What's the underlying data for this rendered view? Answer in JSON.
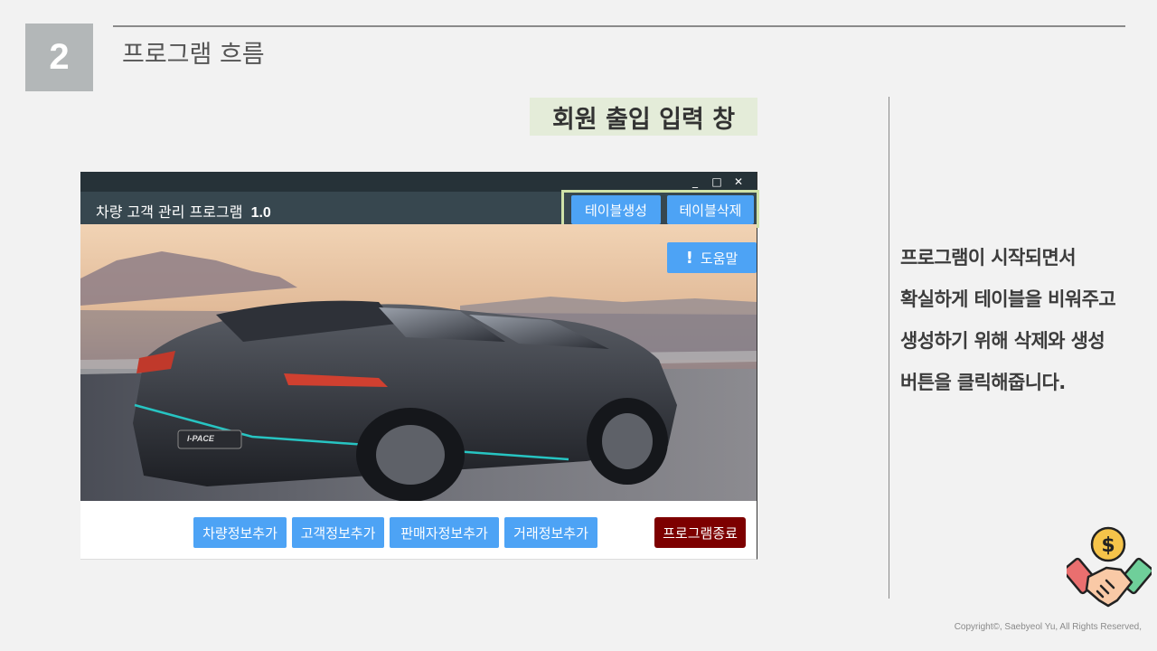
{
  "slide": {
    "number": "2",
    "title": "프로그램 흐름",
    "caption": "회원 출입 입력 창",
    "description_lines": [
      "프로그램이 시작되면서",
      "확실하게 테이블을 비워주고",
      "생성하기 위해 삭제와 생성",
      "버튼을 클릭해줍니다."
    ],
    "copyright": "Copyright©, Saebyeol Yu, All Rights Reserved,"
  },
  "app": {
    "title": "차량 고객 관리 프로그램",
    "version": "1.0",
    "window_buttons": {
      "minimize": "_",
      "maximize": "□",
      "close": "✕"
    },
    "create_table_label": "테이블생성",
    "delete_table_label": "테이블삭제",
    "help_icon": "!",
    "help_label": "도움말",
    "bottom_buttons": [
      "차량정보추가",
      "고객정보추가",
      "판매자정보추가",
      "거래정보추가"
    ],
    "exit_label": "프로그램종료",
    "car_badge": "I-PACE"
  },
  "colors": {
    "accent_blue": "#4da3f5",
    "titlebar": "#263238",
    "appbar": "#37474f",
    "exit_red": "#7d0000",
    "highlight_green": "#cfe2a8"
  },
  "icons": {
    "deal": "handshake-coin-icon"
  }
}
